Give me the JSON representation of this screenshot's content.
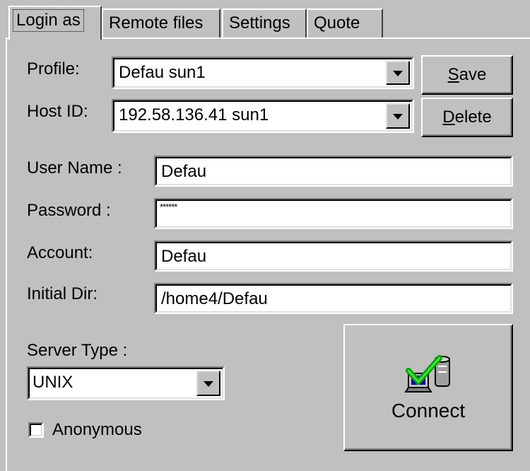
{
  "tabs": [
    "Login as",
    "Remote files",
    "Settings",
    "Quote"
  ],
  "profile": {
    "label": "Profile:",
    "value": "Defau sun1"
  },
  "host": {
    "label": "Host ID:",
    "value": "192.58.136.41 sun1"
  },
  "buttons": {
    "save": "ave",
    "save_key": "S",
    "delete": "elete",
    "delete_key": "D",
    "connect": "Connect"
  },
  "user": {
    "label": "User Name :",
    "value": "Defau"
  },
  "password": {
    "label": "Password :",
    "value": "******"
  },
  "account": {
    "label": "Account:",
    "value": "Defau"
  },
  "initial_dir": {
    "label": "Initial Dir:",
    "value": "/home4/Defau"
  },
  "server_type": {
    "label": "Server Type :",
    "value": "UNIX"
  },
  "anonymous": {
    "label": "Anonymous",
    "checked": false
  }
}
